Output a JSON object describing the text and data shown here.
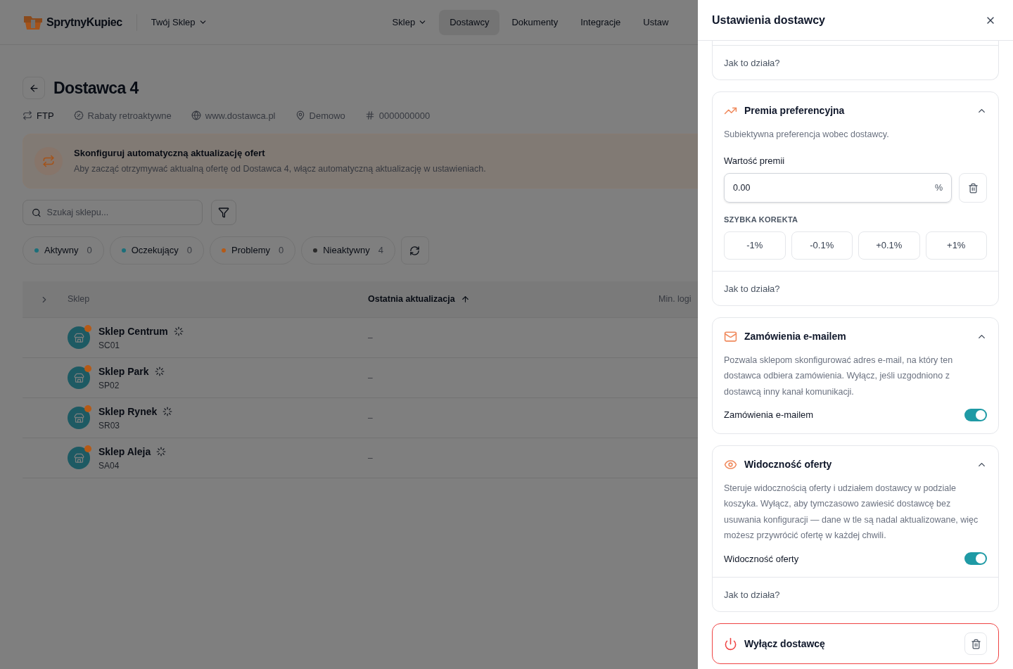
{
  "header": {
    "logo": "SprytnyKupiec",
    "store_switcher": "Twój Sklep",
    "nav": [
      {
        "label": "Sklep",
        "selected": false,
        "has_menu": true
      },
      {
        "label": "Dostawcy",
        "selected": true,
        "has_menu": false
      },
      {
        "label": "Dokumenty",
        "selected": false,
        "has_menu": false
      },
      {
        "label": "Integracje",
        "selected": false,
        "has_menu": false
      },
      {
        "label": "Ustaw",
        "selected": false,
        "has_menu": false
      }
    ]
  },
  "supplier": {
    "title": "Dostawca 4",
    "meta": [
      {
        "kind": "ftp",
        "text": "FTP"
      },
      {
        "kind": "discount",
        "text": "Rabaty retroaktywne"
      },
      {
        "kind": "website",
        "text": "www.dostawca.pl"
      },
      {
        "kind": "location",
        "text": "Demowo"
      },
      {
        "kind": "number",
        "text": "0000000000"
      }
    ]
  },
  "banner": {
    "title": "Skonfiguruj automatyczną aktualizację ofert",
    "text": "Aby zacząć otrzymywać aktualną ofertę od Dostawca 4, włącz automatyczną aktualizację w ustawieniach."
  },
  "search": {
    "placeholder": "Szukaj sklepu..."
  },
  "status_filters": [
    {
      "label": "Aktywny",
      "count": "0",
      "color": "#1c6f7a"
    },
    {
      "label": "Oczekujący",
      "count": "0",
      "color": "#1c6f7a"
    },
    {
      "label": "Problemy",
      "count": "0",
      "color": "#b55a17"
    },
    {
      "label": "Nieaktywny",
      "count": "4",
      "color": "#2a2a2a"
    }
  ],
  "table": {
    "columns": [
      {
        "label": "Sklep",
        "sorted": false
      },
      {
        "label": "Ostatnia aktualizacja",
        "sorted": true
      },
      {
        "label": "Min. logi",
        "sorted": false
      }
    ],
    "rows": [
      {
        "name": "Sklep Centrum",
        "code": "SC01",
        "last_update": "–"
      },
      {
        "name": "Sklep Park",
        "code": "SP02",
        "last_update": "–"
      },
      {
        "name": "Sklep Rynek",
        "code": "SR03",
        "last_update": "–"
      },
      {
        "name": "Sklep Aleja",
        "code": "SA04",
        "last_update": "–"
      }
    ]
  },
  "drawer": {
    "title": "Ustawienia dostawcy",
    "sections": [
      {
        "kind": "help_only",
        "help": "Jak to działa?"
      },
      {
        "kind": "premium",
        "title": "Premia preferencyjna",
        "expanded": true,
        "description": "Subiektywna preferencja wobec dostawcy.",
        "field_label": "Wartość premii",
        "value": "0.00",
        "unit": "%",
        "quick_label": "SZYBKA KOREKTA",
        "quick_buttons": [
          "-1%",
          "-0.1%",
          "+0.1%",
          "+1%"
        ],
        "help": "Jak to działa?"
      },
      {
        "kind": "toggle",
        "title": "Zamówienia e-mailem",
        "expanded": true,
        "description": "Pozwala sklepom skonfigurować adres e-mail, na który ten dostawca odbiera zamówienia. Wyłącz, jeśli uzgodniono z dostawcą inny kanał komunikacji.",
        "toggle_label": "Zamówienia e-mailem",
        "on": true
      },
      {
        "kind": "toggle",
        "title": "Widoczność oferty",
        "expanded": true,
        "description": "Steruje widocznością oferty i udziałem dostawcy w podziale koszyka. Wyłącz, aby tymczasowo zawiesić dostawcę bez usuwania konfiguracji — dane w tle są nadal aktualizowane, więc możesz przywrócić ofertę w każdej chwili.",
        "toggle_label": "Widoczność oferty",
        "on": true,
        "help": "Jak to działa?"
      }
    ],
    "danger": {
      "title": "Wyłącz dostawcę"
    }
  }
}
